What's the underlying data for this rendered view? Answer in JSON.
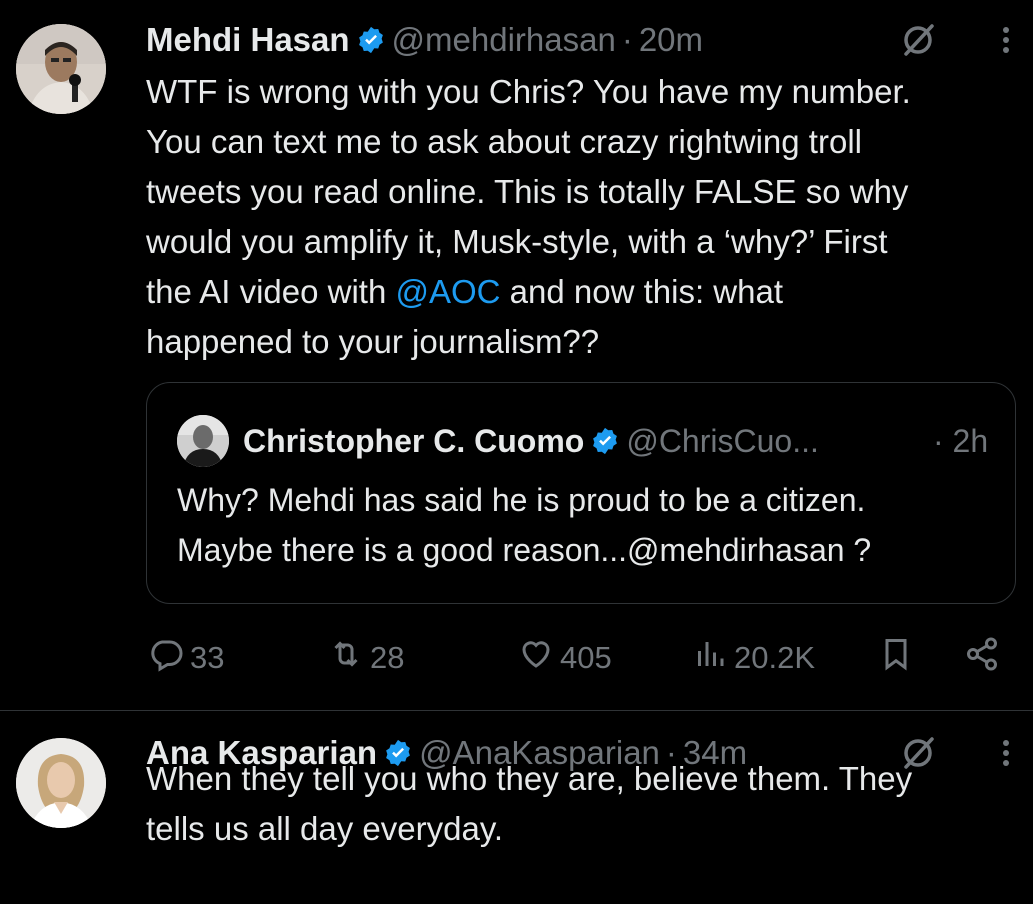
{
  "tweets": [
    {
      "name": "Mehdi Hasan",
      "handle": "@mehdirhasan",
      "time": "20m",
      "text_parts": [
        "WTF is wrong with you Chris? You have my number.\nYou can text me to ask about crazy rightwing troll\ntweets you read online. This is totally FALSE so why\nwould you amplify it, Musk-style, with a ‘why?’ First\nthe AI video with ",
        "@AOC",
        " and now this: what\nhappened to your journalism??"
      ],
      "quote": {
        "name": "Christopher C. Cuomo",
        "handle": "@ChrisCuo...",
        "time": "2h",
        "text": "Why? Mehdi has said he is proud to be a citizen.\nMaybe there is a good reason...@mehdirhasan ?"
      },
      "stats": {
        "replies": "33",
        "reposts": "28",
        "likes": "405",
        "views": "20.2K"
      }
    },
    {
      "name": "Ana Kasparian",
      "handle": "@AnaKasparian",
      "time": "34m",
      "text": "When they tell you who they are, believe them. They\ntells us all day everyday."
    }
  ],
  "separator": "·",
  "colors": {
    "background": "#000000",
    "text": "#e7e9ea",
    "muted": "#71767b",
    "link": "#1d9bf0",
    "verified": "#1d9bf0",
    "border": "#2f3336"
  },
  "icons": [
    "verified-badge-icon",
    "grok-icon",
    "more-icon",
    "reply-icon",
    "repost-icon",
    "like-icon",
    "views-icon",
    "bookmark-icon",
    "share-icon"
  ]
}
